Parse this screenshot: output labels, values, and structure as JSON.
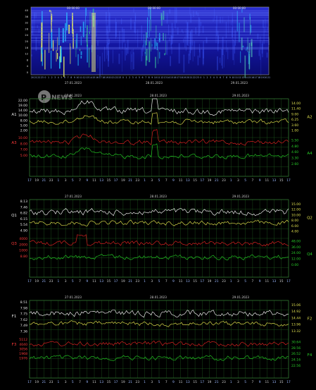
{
  "spectrogram": {
    "top_labels": [
      "00:00:00",
      "00:00:00",
      "00:00:00"
    ],
    "y_ticks": [
      "40",
      "36",
      "32",
      "28",
      "24",
      "20",
      "16",
      "12",
      "8",
      "4",
      "0"
    ],
    "hour_labels": [
      "20",
      "21",
      "22",
      "23",
      "0",
      "1",
      "2",
      "3",
      "4",
      "5",
      "6",
      "7",
      "8",
      "9",
      "10",
      "11",
      "12",
      "13",
      "14",
      "15",
      "16",
      "17",
      "18",
      "19",
      "20",
      "21",
      "22",
      "23",
      "0",
      "1",
      "2",
      "3",
      "4",
      "5",
      "6",
      "7",
      "8",
      "9",
      "10",
      "11",
      "12",
      "13",
      "14",
      "15",
      "16",
      "17",
      "18",
      "19",
      "20",
      "21",
      "22",
      "23",
      "0",
      "1",
      "2",
      "3",
      "4",
      "5",
      "6",
      "7",
      "8",
      "9",
      "10",
      "11",
      "12",
      "13",
      "14",
      "15",
      "16",
      "17",
      "18",
      "19",
      "20",
      "21"
    ]
  },
  "dates": [
    "27.01.2023",
    "28.01.2023",
    "29.01.2023"
  ],
  "panels": [
    {
      "left_labels": [
        "A1",
        "A3"
      ],
      "right_labels": [
        "A2",
        "A4"
      ],
      "left_ticks_top": [
        "22.00",
        "19.00",
        "14.00",
        "10.00",
        "8.00",
        "5.00",
        "2.00"
      ],
      "left_ticks_bottom": [
        "10.00",
        "8.00",
        "7.00",
        "5.00"
      ],
      "right_ticks_top": [
        "14.00",
        "11.40",
        "9.00",
        "6.25",
        "3.60",
        "1.00"
      ],
      "right_ticks_bottom": [
        "5.50",
        "4.80",
        "4.60",
        "3.30",
        "2.60"
      ],
      "hour_labels": [
        "17",
        "19",
        "21",
        "23",
        "1",
        "3",
        "5",
        "7",
        "9",
        "11",
        "13",
        "15",
        "17",
        "19",
        "21",
        "23",
        "1",
        "3",
        "5",
        "7",
        "9",
        "11",
        "13",
        "15",
        "17",
        "19",
        "21",
        "23",
        "1",
        "3",
        "5",
        "7",
        "9",
        "11",
        "13",
        "15",
        "17"
      ]
    },
    {
      "left_labels": [
        "Q1",
        "Q3"
      ],
      "right_labels": [
        "Q2",
        "Q4"
      ],
      "left_ticks_top": [
        "8.13",
        "7.46",
        "6.82",
        "6.15",
        "5.54",
        "4.90"
      ],
      "left_ticks_bottom": [
        "4000",
        "2000",
        "1000",
        "8.80"
      ],
      "right_ticks_top": [
        "15.00",
        "12.00",
        "10.00",
        "8.00",
        "6.00",
        "4.00"
      ],
      "right_ticks_bottom": [
        "48.00",
        "36.00",
        "24.00",
        "12.00",
        "0.00"
      ],
      "hour_labels": [
        "17",
        "19",
        "21",
        "23",
        "1",
        "3",
        "5",
        "7",
        "9",
        "11",
        "13",
        "15",
        "17",
        "19",
        "21",
        "23",
        "1",
        "3",
        "5",
        "7",
        "9",
        "11",
        "13",
        "15",
        "17",
        "19",
        "21",
        "23",
        "1",
        "3",
        "5",
        "7",
        "9",
        "11",
        "13",
        "15",
        "17"
      ]
    },
    {
      "left_labels": [
        "F1",
        "F3"
      ],
      "right_labels": [
        "F2",
        "F4"
      ],
      "left_ticks_top": [
        "8.51",
        "7.98",
        "7.75",
        "7.62",
        "7.49",
        "7.36"
      ],
      "left_ticks_bottom": [
        "5112",
        "4040",
        "3056",
        "1968",
        "1976"
      ],
      "right_ticks_top": [
        "15.06",
        "14.92",
        "14.44",
        "13.96",
        "13.32"
      ],
      "right_ticks_bottom": [
        "30.64",
        "28.56",
        "26.52",
        "24.16",
        "22.56"
      ],
      "hour_labels": [
        "17",
        "19",
        "21",
        "23",
        "1",
        "3",
        "5",
        "7",
        "9",
        "11",
        "13",
        "15",
        "17",
        "19",
        "21",
        "23",
        "1",
        "3",
        "5",
        "7",
        "9",
        "11",
        "13",
        "15",
        "17",
        "19",
        "21",
        "23",
        "1",
        "3",
        "5",
        "7",
        "9",
        "11",
        "13",
        "15",
        "17"
      ]
    }
  ],
  "watermark": "NEWS",
  "colors": {
    "white": "#e8e8e8",
    "yellow": "#d8d84a",
    "red": "#d42020",
    "green": "#22c022",
    "grid": "#1f5a1f",
    "axis": "#8fd08f",
    "tick_left": "#e8e8e8",
    "tick_red": "#ff3a3a",
    "tick_yellow": "#e0e050",
    "tick_green": "#2ad02a",
    "date": "#cfcfcf"
  }
}
